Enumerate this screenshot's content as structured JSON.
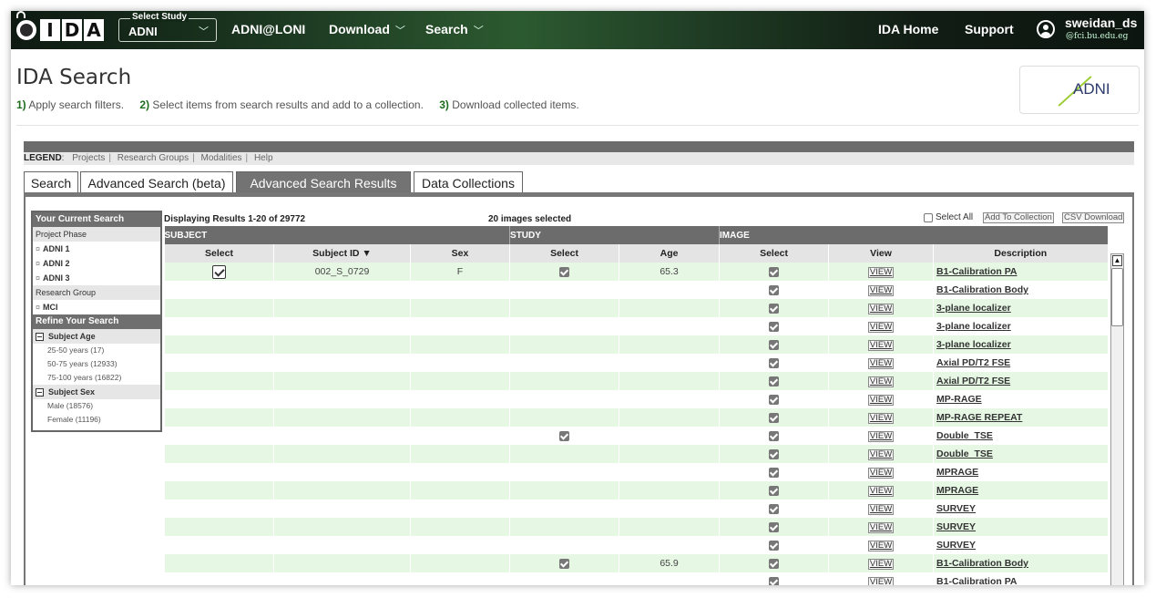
{
  "app": {
    "logo_text": "IDA",
    "study_select_caption": "Select Study",
    "study_select_value": "ADNI",
    "nav": [
      {
        "label": "ADNI@LONI"
      },
      {
        "label": "Download"
      },
      {
        "label": "Search"
      }
    ],
    "right_nav": [
      {
        "label": "IDA Home"
      },
      {
        "label": "Support"
      }
    ],
    "user": {
      "name": "sweidan_ds",
      "email": "@fci.bu.edu.eg"
    }
  },
  "header": {
    "title": "IDA Search",
    "steps": [
      {
        "num": "1)",
        "text": "Apply search filters."
      },
      {
        "num": "2)",
        "text": "Select items from search results and add to a collection."
      },
      {
        "num": "3)",
        "text": "Download collected items."
      }
    ],
    "partner_logo_text": "ADNI"
  },
  "legend": {
    "label": "LEGEND",
    "links": [
      "Projects",
      "Research Groups",
      "Modalities",
      "Help"
    ]
  },
  "tabs": [
    {
      "label": "Search",
      "active": false
    },
    {
      "label": "Advanced Search (beta)",
      "active": false
    },
    {
      "label": "Advanced Search Results",
      "active": true
    },
    {
      "label": "Data Collections",
      "active": false
    }
  ],
  "sidebar": {
    "current_search_title": "Your Current Search",
    "project_phase_label": "Project Phase",
    "phases": [
      "ADNI 1",
      "ADNI 2",
      "ADNI 3"
    ],
    "research_group_label": "Research Group",
    "groups": [
      "MCI"
    ],
    "refine_title": "Refine Your Search",
    "age_group": "Subject Age",
    "age_options": [
      "25-50 years (17)",
      "50-75 years (12933)",
      "75-100 years (16822)"
    ],
    "sex_group": "Subject Sex",
    "sex_options": [
      "Male (18576)",
      "Female (11196)"
    ]
  },
  "results": {
    "displaying": "Displaying Results 1-20 of 29772",
    "selected": "20 images selected",
    "select_all": "Select All",
    "add_to_collection": "Add To Collection",
    "csv_download": "CSV Download",
    "group_headers": {
      "subject": "SUBJECT",
      "study": "STUDY",
      "image": "IMAGE"
    },
    "columns": {
      "select": "Select",
      "subject_id": "Subject ID ▼",
      "sex": "Sex",
      "study_select": "Select",
      "age": "Age",
      "image_select": "Select",
      "view": "View",
      "description": "Description"
    },
    "view_label": "VIEW",
    "rows": [
      {
        "subject_select": true,
        "subject_id": "002_S_0729",
        "sex": "F",
        "study_select": true,
        "age": "65.3",
        "description": "B1-Calibration PA"
      },
      {
        "subject_select": false,
        "subject_id": "",
        "sex": "",
        "study_select": false,
        "age": "",
        "description": "B1-Calibration Body"
      },
      {
        "subject_select": false,
        "subject_id": "",
        "sex": "",
        "study_select": false,
        "age": "",
        "description": "3-plane localizer"
      },
      {
        "subject_select": false,
        "subject_id": "",
        "sex": "",
        "study_select": false,
        "age": "",
        "description": "3-plane localizer"
      },
      {
        "subject_select": false,
        "subject_id": "",
        "sex": "",
        "study_select": false,
        "age": "",
        "description": "3-plane localizer"
      },
      {
        "subject_select": false,
        "subject_id": "",
        "sex": "",
        "study_select": false,
        "age": "",
        "description": "Axial PD/T2 FSE"
      },
      {
        "subject_select": false,
        "subject_id": "",
        "sex": "",
        "study_select": false,
        "age": "",
        "description": "Axial PD/T2 FSE"
      },
      {
        "subject_select": false,
        "subject_id": "",
        "sex": "",
        "study_select": false,
        "age": "",
        "description": "MP-RAGE"
      },
      {
        "subject_select": false,
        "subject_id": "",
        "sex": "",
        "study_select": false,
        "age": "",
        "description": "MP-RAGE REPEAT"
      },
      {
        "subject_select": false,
        "subject_id": "",
        "sex": "",
        "study_select": true,
        "age": "",
        "description": "Double_TSE"
      },
      {
        "subject_select": false,
        "subject_id": "",
        "sex": "",
        "study_select": false,
        "age": "",
        "description": "Double_TSE"
      },
      {
        "subject_select": false,
        "subject_id": "",
        "sex": "",
        "study_select": false,
        "age": "",
        "description": "MPRAGE"
      },
      {
        "subject_select": false,
        "subject_id": "",
        "sex": "",
        "study_select": false,
        "age": "",
        "description": "MPRAGE"
      },
      {
        "subject_select": false,
        "subject_id": "",
        "sex": "",
        "study_select": false,
        "age": "",
        "description": "SURVEY"
      },
      {
        "subject_select": false,
        "subject_id": "",
        "sex": "",
        "study_select": false,
        "age": "",
        "description": "SURVEY"
      },
      {
        "subject_select": false,
        "subject_id": "",
        "sex": "",
        "study_select": false,
        "age": "",
        "description": "SURVEY"
      },
      {
        "subject_select": false,
        "subject_id": "",
        "sex": "",
        "study_select": true,
        "age": "65.9",
        "description": "B1-Calibration Body"
      },
      {
        "subject_select": false,
        "subject_id": "",
        "sex": "",
        "study_select": false,
        "age": "",
        "description": "B1-Calibration PA"
      }
    ]
  }
}
